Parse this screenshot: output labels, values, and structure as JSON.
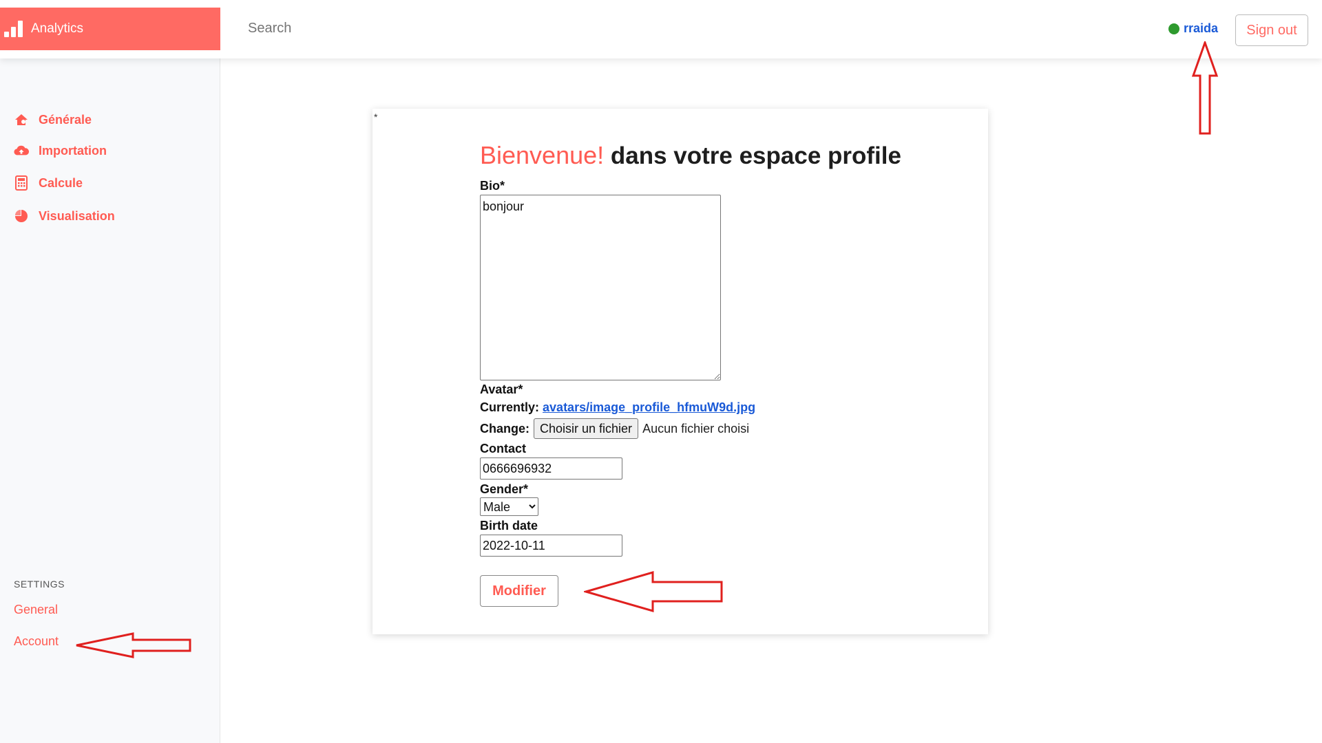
{
  "topbar": {
    "brand": "Analytics",
    "search_placeholder": "Search",
    "username": "rraida",
    "signout_label": "Sign out"
  },
  "sidebar": {
    "items": [
      {
        "label": "Générale",
        "icon": "home-icon"
      },
      {
        "label": "Importation",
        "icon": "cloud-upload-icon"
      },
      {
        "label": "Calcule",
        "icon": "calculator-icon"
      },
      {
        "label": "Visualisation",
        "icon": "pie-chart-icon"
      }
    ],
    "settings_title": "SETTINGS",
    "settings_links": [
      "General",
      "Account"
    ]
  },
  "form": {
    "asterisk": "*",
    "heading_highlight": "Bienvenue!",
    "heading_rest": " dans votre espace profile",
    "bio_label": "Bio*",
    "bio_value": "bonjour",
    "avatar_label": "Avatar*",
    "currently_label": "Currently:",
    "avatar_file": "avatars/image_profile_hfmuW9d.jpg",
    "change_label": "Change:",
    "file_button": "Choisir un fichier",
    "no_file": "Aucun fichier choisi",
    "contact_label": "Contact",
    "contact_value": "0666696932",
    "gender_label": "Gender*",
    "gender_value": "Male",
    "birth_label": "Birth date",
    "birth_value": "2022-10-11",
    "submit_label": "Modifier"
  },
  "colors": {
    "accent": "#ff6a63",
    "link": "#1a5ad7",
    "online": "#2e9a2e",
    "annotation": "#e0201e"
  }
}
